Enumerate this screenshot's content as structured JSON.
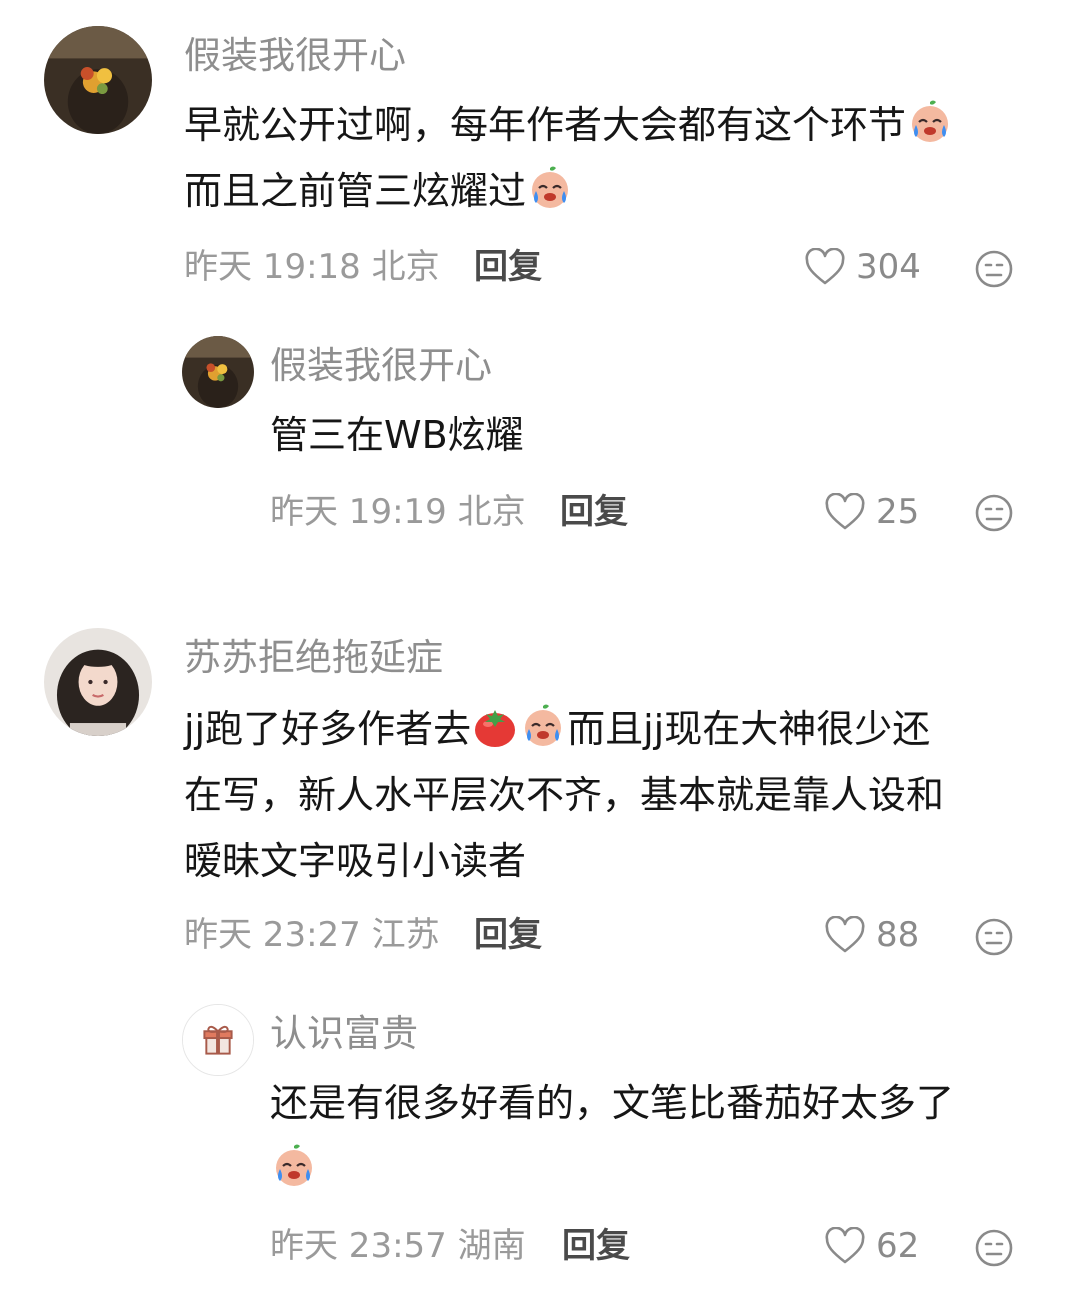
{
  "comments": [
    {
      "user": "假装我很开心",
      "line1": "早就公开过啊，每年作者大会都有这个环节",
      "line2": "而且之前管三炫耀过",
      "time": "昨天 19:18 北京",
      "reply": "回复",
      "likes": "304",
      "replies": [
        {
          "user": "假装我很开心",
          "line1": "管三在WB炫耀",
          "time": "昨天 19:19 北京",
          "reply": "回复",
          "likes": "25"
        }
      ]
    },
    {
      "user": "苏苏拒绝拖延症",
      "line1a": "jj跑了好多作者去",
      "line1b": "而且jj现在大神很少还",
      "line2": "在写，新人水平层次不齐，基本就是靠人设和",
      "line3": "暧昧文字吸引小读者",
      "time": "昨天 23:27 江苏",
      "reply": "回复",
      "likes": "88",
      "replies": [
        {
          "user": "认识富贵",
          "line1": "还是有很多好看的，文笔比番茄好太多了",
          "time": "昨天 23:57 湖南",
          "reply": "回复",
          "likes": "62"
        }
      ]
    }
  ],
  "icons": {
    "like": "heart-outline-icon",
    "dislike": "neutral-face-icon",
    "crying": "crying-face-emoji",
    "tomato": "tomato-emoji",
    "gift": "gift-icon"
  }
}
